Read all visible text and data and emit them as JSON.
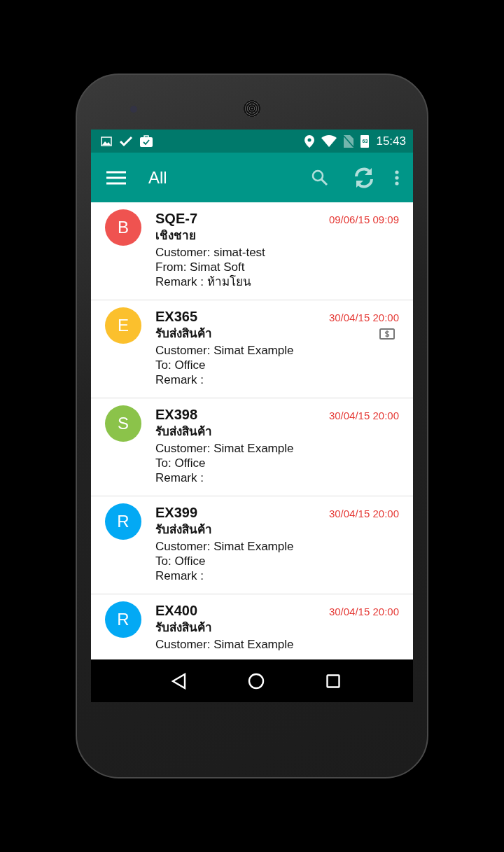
{
  "status_bar": {
    "battery_level": "63",
    "time": "15:43"
  },
  "app_bar": {
    "title": "All"
  },
  "orders": [
    {
      "avatar_letter": "B",
      "color": "#ef5350",
      "code": "SQE-7",
      "datetime": "09/06/15 09:09",
      "type": "เชิงชาย",
      "payment_flag": false,
      "lines": [
        "Customer: simat-test",
        "From: Simat Soft",
        "Remark : ห้ามโยน"
      ]
    },
    {
      "avatar_letter": "E",
      "color": "#fbc02d",
      "code": "EX365",
      "datetime": "30/04/15 20:00",
      "type": "รับส่งสินค้า",
      "payment_flag": true,
      "lines": [
        "Customer: Simat Example",
        "To: Office",
        "Remark :"
      ]
    },
    {
      "avatar_letter": "S",
      "color": "#8bc34a",
      "code": "EX398",
      "datetime": "30/04/15 20:00",
      "type": "รับส่งสินค้า",
      "payment_flag": false,
      "lines": [
        "Customer: Simat Example",
        "To: Office",
        "Remark :"
      ]
    },
    {
      "avatar_letter": "R",
      "color": "#03a9f4",
      "code": "EX399",
      "datetime": "30/04/15 20:00",
      "type": "รับส่งสินค้า",
      "payment_flag": false,
      "lines": [
        "Customer: Simat Example",
        "To: Office",
        "Remark :"
      ]
    },
    {
      "avatar_letter": "R",
      "color": "#03a9f4",
      "code": "EX400",
      "datetime": "30/04/15 20:00",
      "type": "รับส่งสินค้า",
      "payment_flag": false,
      "lines": [
        "Customer: Simat Example"
      ]
    }
  ]
}
